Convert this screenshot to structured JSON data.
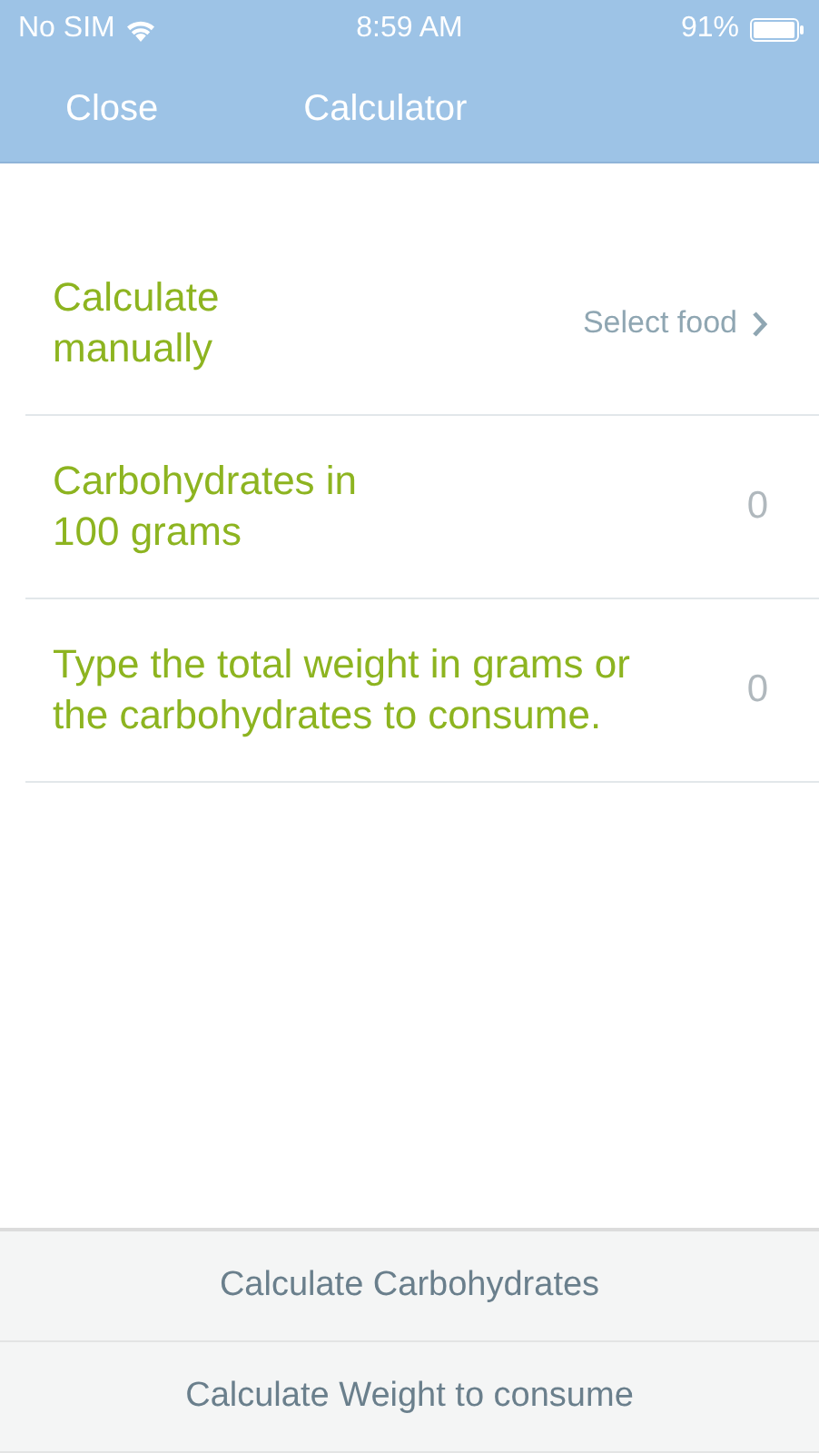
{
  "status_bar": {
    "carrier": "No SIM",
    "time": "8:59 AM",
    "battery": "91%"
  },
  "nav_bar": {
    "left_button": "Close",
    "title": "Calculator"
  },
  "rows": [
    {
      "kind": "link",
      "label": "Calculate manually",
      "value": "Select food"
    },
    {
      "kind": "value",
      "label": "Carbohydrates in 100 grams",
      "value": "0"
    },
    {
      "kind": "value",
      "label": "Type the total weight in grams or the carbohydrates to consume.",
      "value": "0"
    }
  ],
  "buttons": [
    "Calculate Carbohydrates",
    "Calculate Weight to consume"
  ]
}
